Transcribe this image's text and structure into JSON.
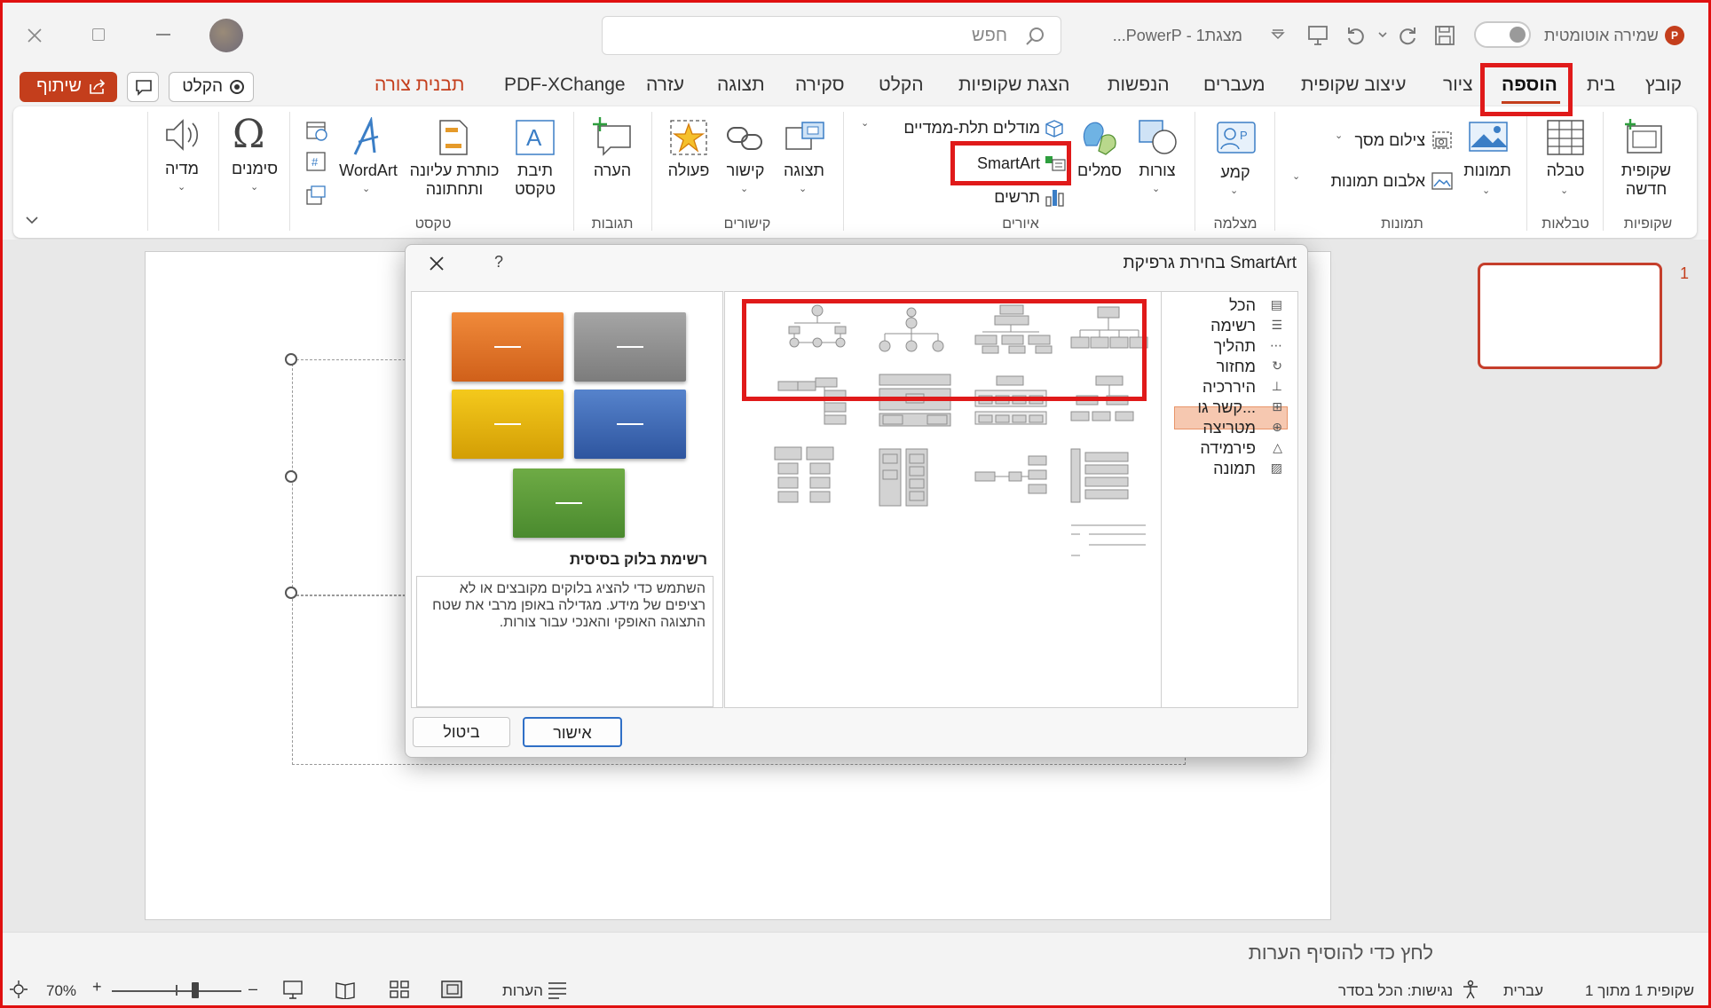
{
  "titlebar": {
    "autosave_label": "שמירה אוטומטית",
    "doc_title": "מצגת1  -  PowerP...",
    "search_placeholder": "חפש"
  },
  "tabs": [
    {
      "label": "קובץ"
    },
    {
      "label": "בית"
    },
    {
      "label": "הוספה",
      "active": true
    },
    {
      "label": "ציור"
    },
    {
      "label": "עיצוב שקופית"
    },
    {
      "label": "מעברים"
    },
    {
      "label": "הנפשות"
    },
    {
      "label": "הצגת שקופיות"
    },
    {
      "label": "הקלט"
    },
    {
      "label": "סקירה"
    },
    {
      "label": "תצוגה"
    },
    {
      "label": "עזרה"
    },
    {
      "label": "PDF-XChange"
    },
    {
      "label": "תבנית צורה",
      "color": "#c43e1c"
    }
  ],
  "toolbar_right": {
    "record_label": "הקלט",
    "share_label": "שיתוף",
    "share_color": "#c43e1c"
  },
  "ribbon": {
    "new_slide": "שקופית\nחדשה",
    "table": "טבלה",
    "images": "תמונות",
    "screenshot": "צילום מסך",
    "photo_album": "אלבום תמונות",
    "cameo": "קמע",
    "shapes": "צורות",
    "icons": "סמלים",
    "models_3d": "מודלים תלת-ממדיים",
    "smartart": "SmartArt",
    "chart": "תרשים",
    "zoom": "תצוגה",
    "link": "קישור",
    "action": "פעולה",
    "comment": "הערה",
    "text_box": "תיבת\nטקסט",
    "header_footer": "כותרת עליונה\nותחתונה",
    "wordart": "WordArt",
    "symbols": "סימנים",
    "media": "מדיה",
    "groups": {
      "slides": "שקופיות",
      "tables": "טבלאות",
      "images": "תמונות",
      "camera": "מצלמה",
      "illustrations": "איורים",
      "links": "קישורים",
      "comments": "תגובות",
      "text": "טקסט"
    }
  },
  "slide_panel": {
    "slide_number": "1"
  },
  "dialog": {
    "title": "בחירת גרפיקת SmartArt",
    "help": "?",
    "categories": [
      {
        "label": "הכל",
        "icon": "all-icon"
      },
      {
        "label": "רשימה",
        "icon": "list-icon"
      },
      {
        "label": "תהליך",
        "icon": "process-icon"
      },
      {
        "label": "מחזור",
        "icon": "cycle-icon"
      },
      {
        "label": "היררכיה",
        "icon": "hierarchy-icon",
        "selected": true
      },
      {
        "label": "קשר גו...",
        "icon": "relationship-icon"
      },
      {
        "label": "מטריצה",
        "icon": "matrix-icon"
      },
      {
        "label": "פירמידה",
        "icon": "pyramid-icon"
      },
      {
        "label": "תמונה",
        "icon": "picture-icon"
      }
    ],
    "preview_title": "רשימת בלוק בסיסית",
    "preview_description": "השתמש כדי להציג בלוקים מקובצים או לא רציפים של מידע. מגדילה באופן מרבי את שטח התצוגה האופקי והאנכי עבור צורות.",
    "preview_colors": [
      "#e2711d",
      "#8c8c8c",
      "#e5b50e",
      "#3b68b5",
      "#5b9a3a"
    ],
    "ok_label": "אישור",
    "cancel_label": "ביטול"
  },
  "notes": {
    "placeholder": "לחץ כדי להוסיף הערות"
  },
  "status": {
    "slide_of": "שקופית 1 מתוך 1",
    "language": "עברית",
    "accessibility": "נגישות: הכל בסדר",
    "notes_label": "הערות",
    "zoom": "70%"
  },
  "colors": {
    "accent": "#c43e1c",
    "highlight": "#e01a1a"
  }
}
